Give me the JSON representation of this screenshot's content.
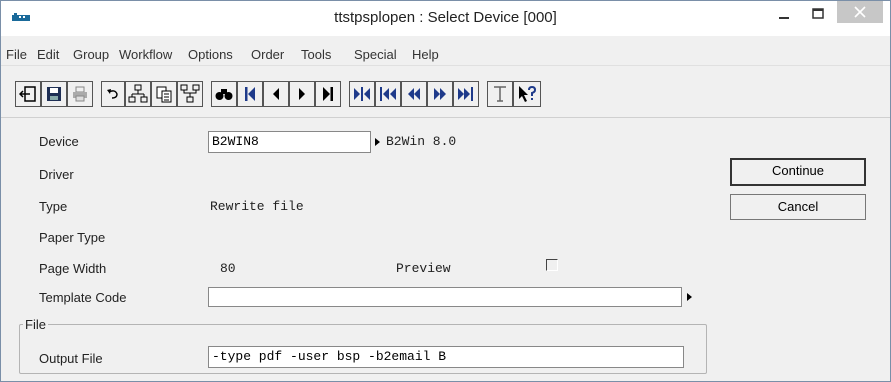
{
  "window": {
    "title": "ttstpsplopen : Select Device [000]"
  },
  "menu": {
    "items": [
      "File",
      "Edit",
      "Group",
      "Workflow",
      "Options",
      "Order",
      "Tools",
      "Special",
      "Help"
    ]
  },
  "toolbar": {
    "icons": [
      "exit-icon",
      "save-icon",
      "print-icon",
      "undo-icon",
      "insert-record-icon",
      "copy-record-icon",
      "delete-record-icon",
      "find-icon",
      "first-record-icon",
      "previous-record-icon",
      "next-record-icon",
      "last-record-icon",
      "first-group-icon",
      "previous-group-icon",
      "previous-page-icon",
      "next-page-icon",
      "last-page-icon",
      "text-icon",
      "help-icon"
    ]
  },
  "form": {
    "device_label": "Device",
    "device_value": "B2WIN8",
    "device_description": "B2Win 8.0",
    "driver_label": "Driver",
    "type_label": "Type",
    "type_value": "Rewrite file",
    "paper_type_label": "Paper Type",
    "page_width_label": "Page Width",
    "page_width_value": "80",
    "preview_label": "Preview",
    "preview_checked": false,
    "template_code_label": "Template Code",
    "template_code_value": "",
    "file_group_label": "File",
    "output_file_label": "Output File",
    "output_file_value": "-type pdf -user bsp -b2email B"
  },
  "buttons": {
    "continue_label": "Continue",
    "cancel_label": "Cancel"
  }
}
